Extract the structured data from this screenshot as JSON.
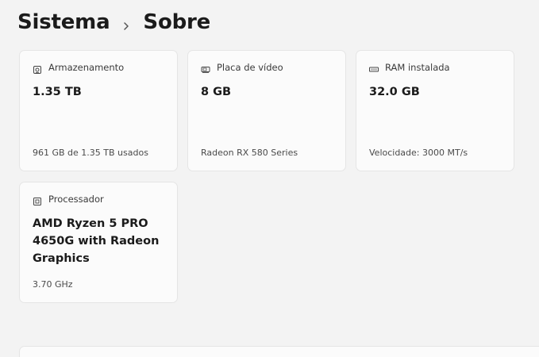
{
  "breadcrumb": {
    "parent": "Sistema",
    "current": "Sobre"
  },
  "cards": {
    "storage": {
      "title": "Armazenamento",
      "value": "1.35 TB",
      "sub": "961 GB de 1.35 TB usados",
      "icon": "storage-icon"
    },
    "gpu": {
      "title": "Placa de vídeo",
      "value": "8 GB",
      "sub": "Radeon RX 580 Series",
      "icon": "gpu-icon"
    },
    "ram": {
      "title": "RAM instalada",
      "value": "32.0 GB",
      "sub": "Velocidade: 3000 MT/s",
      "icon": "ram-icon"
    },
    "cpu": {
      "title": "Processador",
      "value_line1": "AMD Ryzen 5 PRO",
      "value_line2": "4650G with Radeon",
      "value_line3": "Graphics",
      "sub": "3.70 GHz",
      "icon": "processor-icon"
    }
  },
  "colors": {
    "background": "#f3f3f3",
    "card": "#fbfbfb",
    "border": "#e5e5e5"
  }
}
